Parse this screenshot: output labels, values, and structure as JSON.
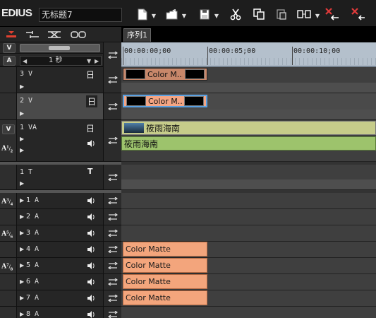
{
  "app": {
    "name": "EDIUS",
    "project_title": "无标题7"
  },
  "sequence_tab": "序列1",
  "timescale": {
    "value": "1 秒"
  },
  "ruler": {
    "timecodes": [
      "00:00:00;00",
      "00:00:05;00",
      "00:00:10;00"
    ]
  },
  "toolbar_icons": [
    "new-project-icon",
    "open-project-icon",
    "save-project-icon",
    "cut-icon",
    "copy-icon",
    "paste-icon",
    "insert-mode-icon",
    "ripple-delete-icon",
    "delete-icon"
  ],
  "tracks": {
    "v3": {
      "name": "3 V",
      "glyph": "日"
    },
    "v2": {
      "name": "2 V",
      "glyph": "日"
    },
    "va1": {
      "name": "1 VA",
      "glyph": "日"
    },
    "t1": {
      "name": "1 T",
      "glyph": "T"
    },
    "audio": [
      {
        "name": "1 A"
      },
      {
        "name": "2 A"
      },
      {
        "name": "3 A"
      },
      {
        "name": "4 A"
      },
      {
        "name": "5 A"
      },
      {
        "name": "6 A"
      },
      {
        "name": "7 A"
      },
      {
        "name": "8 A"
      }
    ]
  },
  "badges": {
    "v": "V",
    "a": "A",
    "a12": "1|2",
    "a34": "3|4",
    "a56": "5|6",
    "a78": "7|8"
  },
  "clips": {
    "v3": "Color M...",
    "v2": "Color M...",
    "va1_video": "筱雨海南",
    "va1_audio": "筱雨海南",
    "a4": "Color Matte",
    "a5": "Color Matte",
    "a6": "Color Matte",
    "a7": "Color Matte"
  },
  "colors": {
    "clip_v3": "#c8876a",
    "clip_v2": "#f4a584",
    "clip_va_video": "#c6cc8a",
    "clip_va_audio": "#9dc36c",
    "clip_audio": "#f3a57c",
    "ruler": "#b4c0cc"
  }
}
